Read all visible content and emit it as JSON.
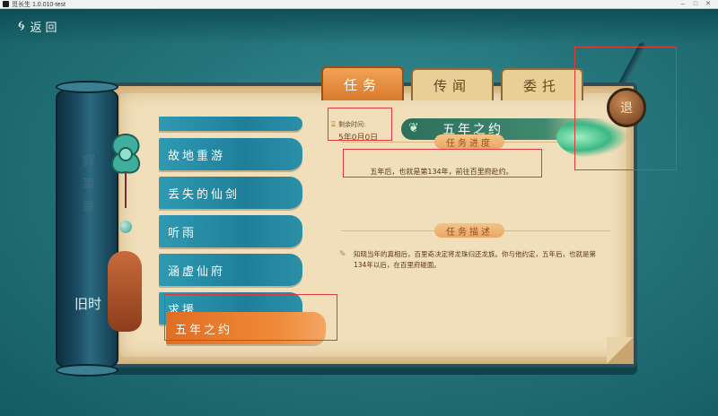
{
  "window": {
    "title": "觅长生 1.0.010-test",
    "controls": {
      "minimize": "–",
      "maximize": "□",
      "close": "✕"
    }
  },
  "header": {
    "back_icon": "cloud-swirl-icon",
    "back_label": "返回"
  },
  "tabs": [
    {
      "label": "任务",
      "active": true
    },
    {
      "label": "传闻",
      "active": false
    },
    {
      "label": "委托",
      "active": false
    }
  ],
  "roller": {
    "vertical_text": "叙事录",
    "label": "旧时"
  },
  "quests": [
    {
      "label": "",
      "partial": true
    },
    {
      "label": "故地重游"
    },
    {
      "label": "丢失的仙剑"
    },
    {
      "label": "听雨"
    },
    {
      "label": "涵虚仙府"
    },
    {
      "label": "求援"
    },
    {
      "label": "五年之约",
      "active": true
    }
  ],
  "detail": {
    "timer_label": "剩余时间:",
    "timer_value": "5年0月0日",
    "title": "五年之约",
    "progress_header": "任务进度",
    "progress_text": "五年后，也就是第134年，前往百里府赴约。",
    "description_header": "任务描述",
    "description_text": "知晓当年的真相后，百里奇决定将龙珠归还龙族。你与他约定，五年后，也就是第134年以后，在百里府碰面。"
  },
  "medallion_label": "退",
  "colors": {
    "active_tab": "#e68a3a",
    "active_quest": "#e9772c",
    "quest_item": "#2b8fa8",
    "highlight": "#e03a3a",
    "paper": "#f0dfba"
  }
}
